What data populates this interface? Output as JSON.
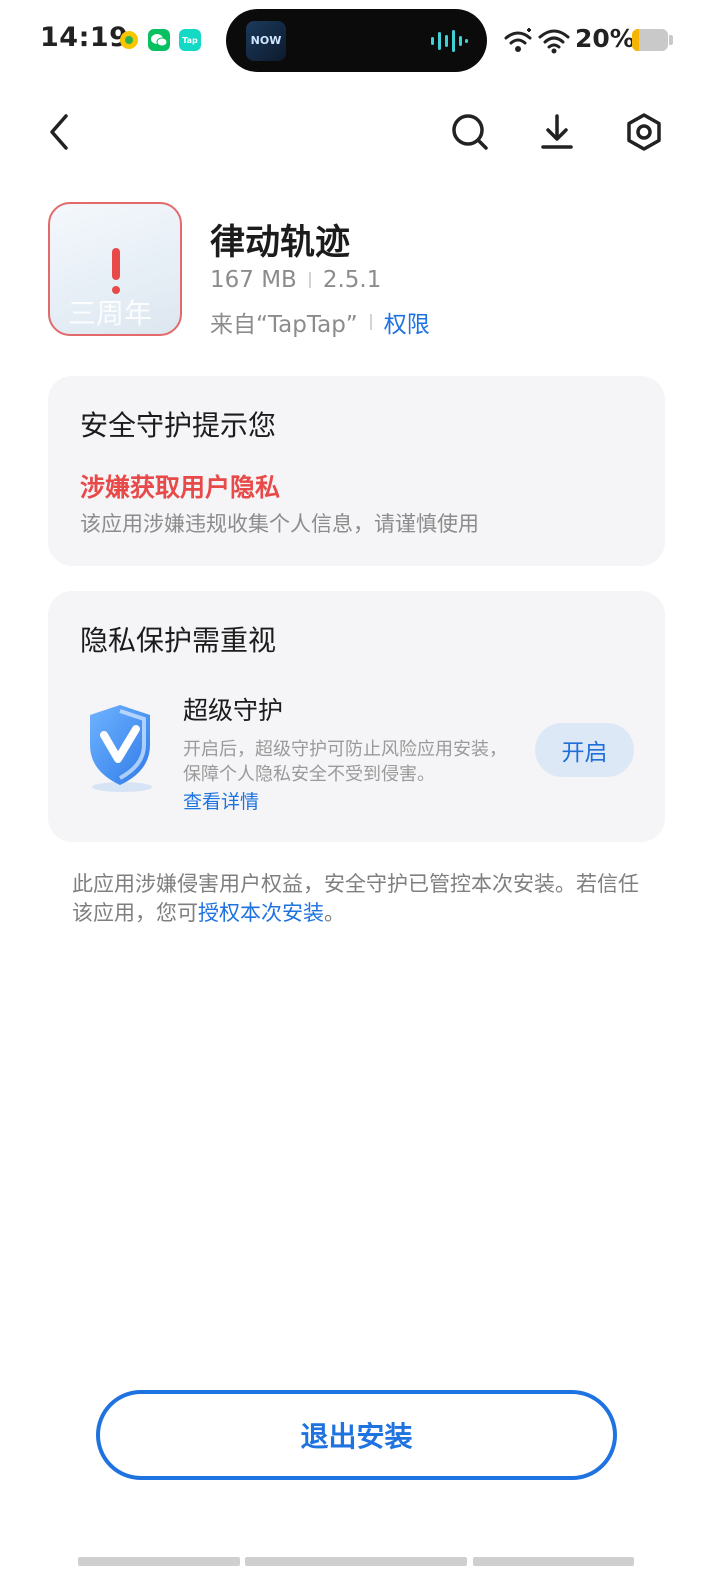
{
  "status_bar": {
    "time": "14:19",
    "battery": "20%",
    "island_badge": "NOW",
    "notification_tap_label": "Tap"
  },
  "toolbar": {
    "icons": [
      "back-icon",
      "search-icon",
      "download-icon",
      "settings-icon"
    ]
  },
  "app": {
    "name": "律动轨迹",
    "size": "167 MB",
    "version": "2.5.1",
    "source": "来自“TapTap”",
    "permissions_link": "权限",
    "icon_watermark": "三周年"
  },
  "security_card": {
    "title": "安全守护提示您",
    "risk_title": "涉嫌获取用户隐私",
    "risk_desc": "该应用涉嫌违规收集个人信息，请谨慎使用"
  },
  "privacy_card": {
    "title": "隐私保护需重视",
    "feature_title": "超级守护",
    "feature_desc": "开启后，超级守护可防止风险应用安装，保障个人隐私安全不受到侵害。",
    "details_link": "查看详情",
    "enable_label": "开启"
  },
  "notice": {
    "text": "此应用涉嫌侵害用户权益，安全守护已管控本次安装。若信任该应用，您可",
    "link": "授权本次安装",
    "suffix": "。"
  },
  "exit_button_label": "退出安装",
  "colors": {
    "accent": "#1f73e0",
    "danger": "#e84a4a",
    "card_bg": "#f5f5f7"
  }
}
